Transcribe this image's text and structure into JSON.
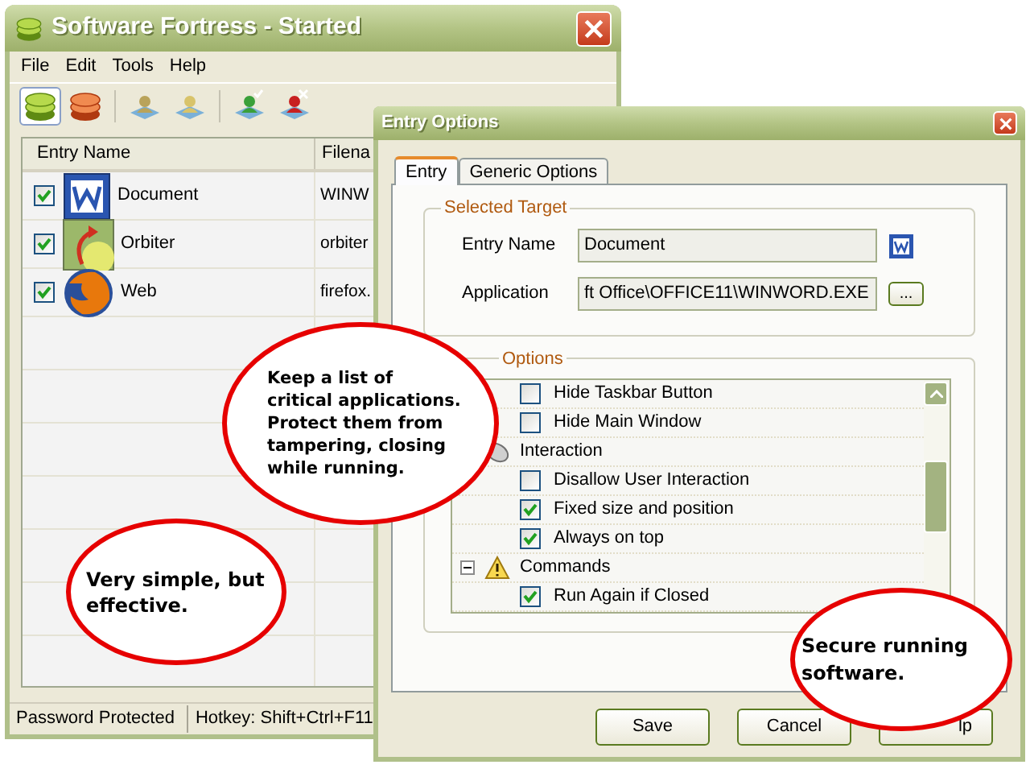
{
  "main_window": {
    "title": "Software Fortress - Started",
    "menu": [
      "File",
      "Edit",
      "Tools",
      "Help"
    ],
    "toolbar": [
      {
        "kind": "layers-green",
        "selected": true
      },
      {
        "kind": "layers-orange",
        "selected": false
      },
      {
        "kind": "users",
        "selected": false
      },
      {
        "kind": "user-lock",
        "selected": false
      },
      {
        "kind": "user-check",
        "selected": false
      },
      {
        "kind": "user-block",
        "selected": false
      }
    ],
    "table": {
      "columns": [
        "Entry Name",
        "Filena"
      ],
      "rows": [
        {
          "checked": true,
          "name": "Document",
          "filename": "WINW"
        },
        {
          "checked": true,
          "name": "Orbiter",
          "filename": "orbiter"
        },
        {
          "checked": true,
          "name": "Web",
          "filename": "firefox."
        }
      ]
    },
    "status_bar": [
      "Password Protected",
      "Hotkey: Shift+Ctrl+F11"
    ]
  },
  "dialog": {
    "title": "Entry Options",
    "tabs": [
      {
        "label": "Entry",
        "selected": true
      },
      {
        "label": "Generic Options",
        "selected": false
      }
    ],
    "selected_target": {
      "title": "Selected Target",
      "fields": [
        {
          "kind": "icon",
          "label": "Entry Name",
          "value": "Document"
        },
        {
          "kind": "browse",
          "label": "Application",
          "value": "ft Office\\OFFICE11\\WINWORD.EXE",
          "button": "..."
        }
      ]
    },
    "options": {
      "title": "Options",
      "items": [
        {
          "kind": "checkbox",
          "label": "Hide Taskbar Button",
          "checked": false
        },
        {
          "kind": "checkbox",
          "label": "Hide Main Window",
          "checked": false
        },
        {
          "kind": "group",
          "label": "Interaction",
          "expanded": true,
          "children": [
            {
              "kind": "checkbox",
              "label": "Disallow User Interaction",
              "checked": false
            },
            {
              "kind": "checkbox",
              "label": "Fixed size and position",
              "checked": true
            },
            {
              "kind": "checkbox",
              "label": "Always on top",
              "checked": true
            }
          ]
        },
        {
          "kind": "group",
          "label": "Commands",
          "expanded": true,
          "children": [
            {
              "kind": "checkbox",
              "label": "Run Again if Closed",
              "checked": true
            }
          ]
        }
      ]
    },
    "buttons": [
      "Save",
      "Cancel",
      "lp"
    ]
  },
  "callouts": [
    "Keep a list of critical applications. Protect them from tampering, closing while running.",
    "Very simple, but effective.",
    "Secure running software."
  ]
}
